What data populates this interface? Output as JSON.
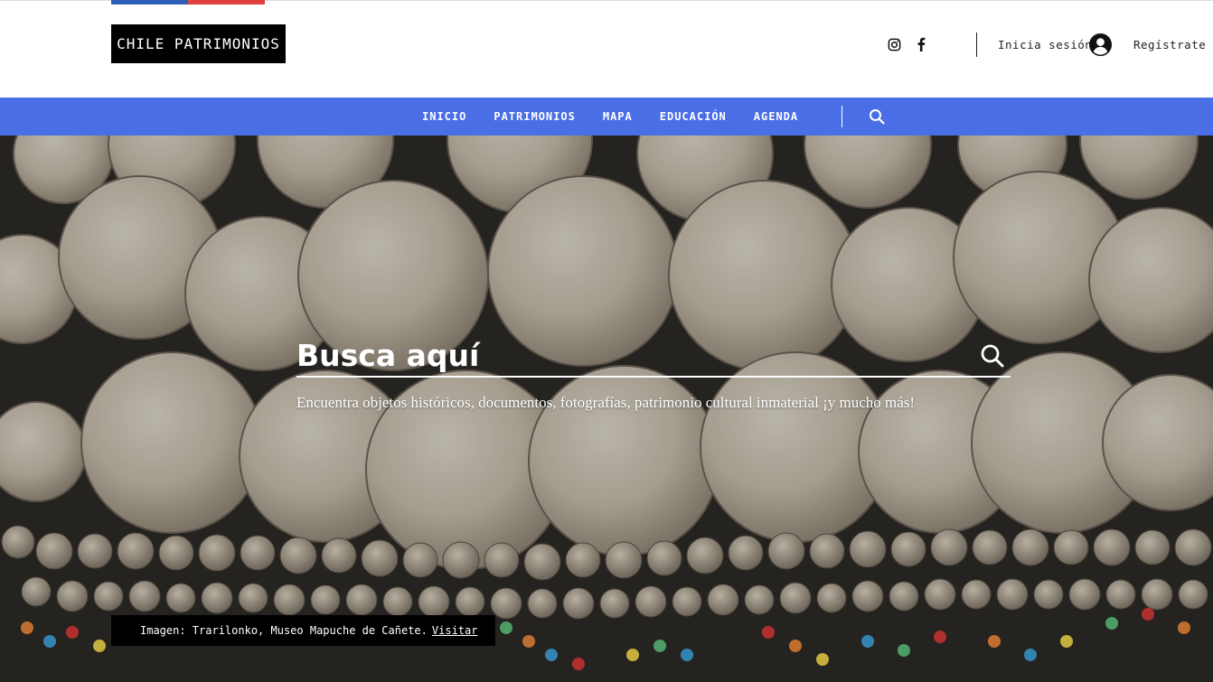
{
  "header": {
    "logo_text": "CHILE PATRIMONIOS",
    "login_label": "Inicia sesión",
    "register_label": "Regístrate",
    "social": [
      "instagram-icon",
      "facebook-icon"
    ]
  },
  "nav": {
    "items": [
      {
        "label": "INICIO"
      },
      {
        "label": "PATRIMONIOS"
      },
      {
        "label": "MAPA"
      },
      {
        "label": "EDUCACIÓN"
      },
      {
        "label": "AGENDA"
      }
    ],
    "search_icon": "search-icon"
  },
  "hero": {
    "search_placeholder": "Busca aquí",
    "tagline": "Encuentra objetos históricos, documentos, fotografías, patrimonio cultural inmaterial ¡y mucho más!",
    "credit_text": "Imagen: Trarilonko, Museo Mapuche de Cañete.",
    "credit_link": "Visitar"
  },
  "colors": {
    "nav_bg": "#4a6ee6",
    "flag_blue": "#2b5fb8",
    "flag_red": "#e0403b",
    "logo_bg": "#000000"
  }
}
